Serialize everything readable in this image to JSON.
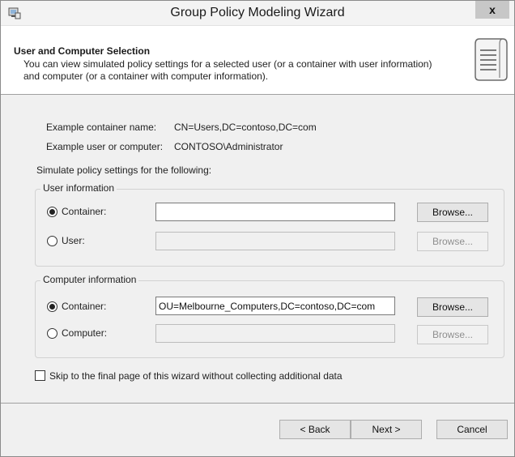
{
  "window": {
    "title": "Group Policy Modeling Wizard",
    "close_label": "x"
  },
  "header": {
    "title": "User and Computer Selection",
    "description": "You can view simulated policy settings for a selected user (or a container with user information) and computer (or a container with computer information)."
  },
  "examples": {
    "container_label": "Example container name:",
    "container_value": "CN=Users,DC=contoso,DC=com",
    "user_label": "Example user or computer:",
    "user_value": "CONTOSO\\Administrator"
  },
  "simulate_label": "Simulate policy settings for the following:",
  "user_info": {
    "legend": "User information",
    "container_label": "Container:",
    "container_value": "",
    "container_selected": true,
    "user_label": "User:",
    "user_value": "",
    "user_selected": false,
    "browse_label": "Browse..."
  },
  "computer_info": {
    "legend": "Computer information",
    "container_label": "Container:",
    "container_value": "OU=Melbourne_Computers,DC=contoso,DC=com",
    "container_selected": true,
    "computer_label": "Computer:",
    "computer_value": "",
    "computer_selected": false,
    "browse_label": "Browse..."
  },
  "skip": {
    "label": "Skip to the final page of this wizard without collecting additional data",
    "checked": false
  },
  "footer": {
    "back_label": "< Back",
    "next_label": "Next >",
    "cancel_label": "Cancel"
  }
}
